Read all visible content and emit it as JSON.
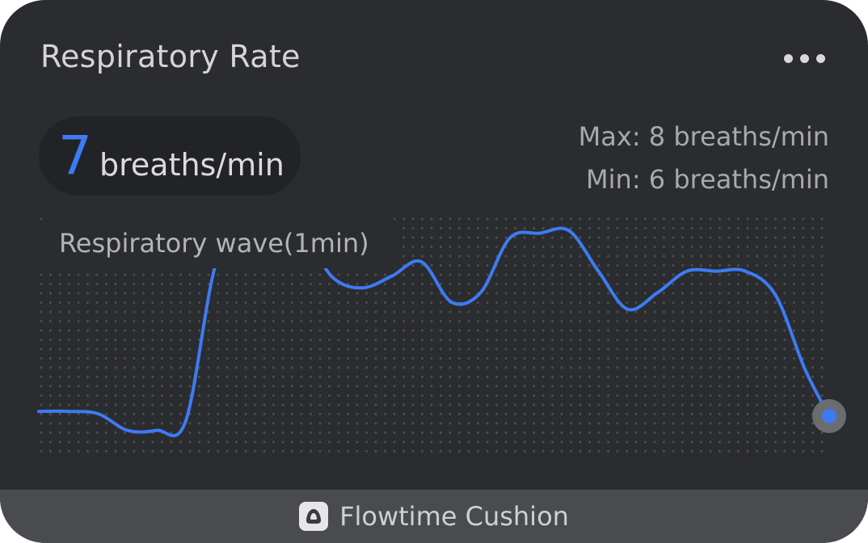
{
  "widget": {
    "title": "Respiratory Rate",
    "more_icon": "ellipsis-icon",
    "current_value": "7",
    "unit": "breaths/min",
    "max_text": "Max: 8 breaths/min",
    "min_text": "Min: 6 breaths/min",
    "wave_label": "Respiratory wave(1min)",
    "accent_color": "#3d7bf3"
  },
  "footer": {
    "icon": "cushion-icon",
    "label": "Flowtime Cushion"
  },
  "chart_data": {
    "type": "line",
    "title": "Respiratory wave(1min)",
    "x": [
      0,
      3.7,
      7.5,
      11.2,
      14.9,
      18.6,
      22.4,
      26.1,
      29.8,
      33.5,
      37.3,
      41,
      44.7,
      48.4,
      52.2,
      55.9,
      59.6,
      63.4,
      67.1,
      70.8,
      74.5,
      78.3,
      82,
      85.7,
      89.4,
      93.2,
      96.9,
      100
    ],
    "values": [
      0.18,
      0.18,
      0.17,
      0.1,
      0.1,
      0.14,
      0.8,
      0.93,
      0.91,
      0.91,
      0.74,
      0.7,
      0.75,
      0.81,
      0.64,
      0.68,
      0.91,
      0.93,
      0.94,
      0.77,
      0.61,
      0.68,
      0.77,
      0.77,
      0.77,
      0.67,
      0.36,
      0.16
    ],
    "xlim": [
      0,
      100
    ],
    "ylim": [
      0,
      1
    ],
    "grid": "dotted",
    "series_color": "#3d7bf3"
  }
}
